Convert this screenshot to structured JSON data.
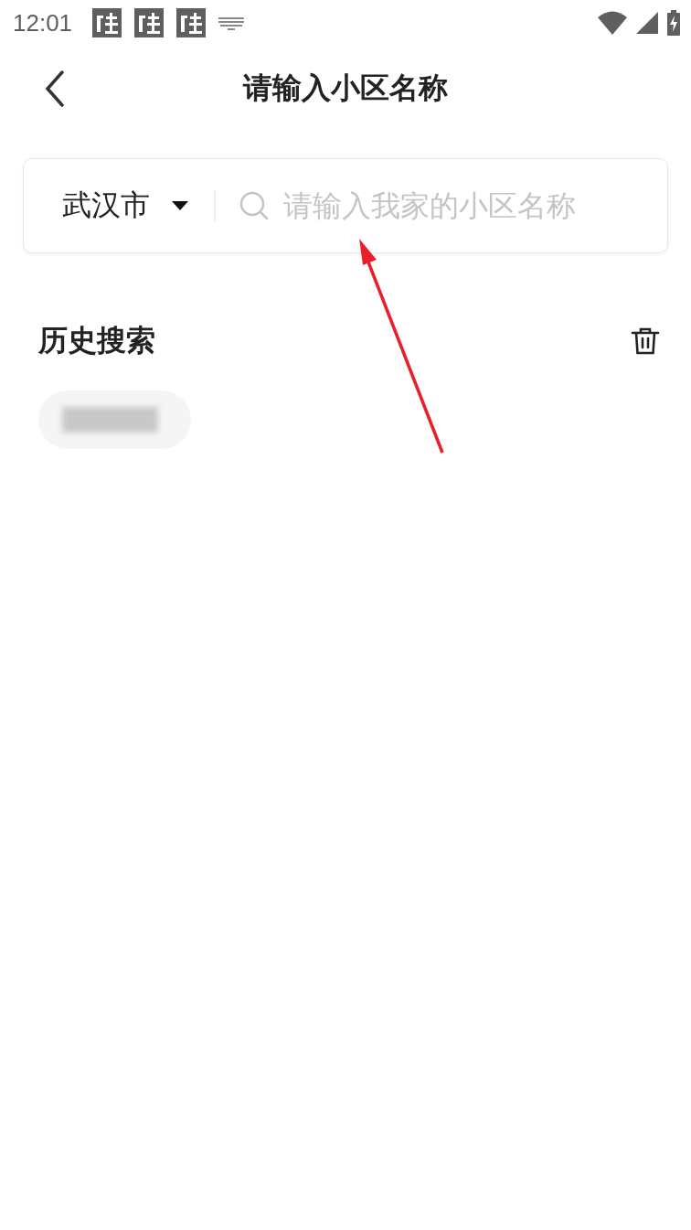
{
  "status_bar": {
    "time": "12:01",
    "notifications": [
      {
        "kind": "app"
      },
      {
        "kind": "app"
      },
      {
        "kind": "app"
      },
      {
        "kind": "keyboard"
      }
    ]
  },
  "header": {
    "title": "请输入小区名称"
  },
  "search": {
    "city": "武汉市",
    "placeholder": "请输入我家的小区名称"
  },
  "history": {
    "title": "历史搜索",
    "items": [
      {
        "kind": "redacted"
      }
    ]
  },
  "annotation": {
    "kind": "arrow"
  }
}
